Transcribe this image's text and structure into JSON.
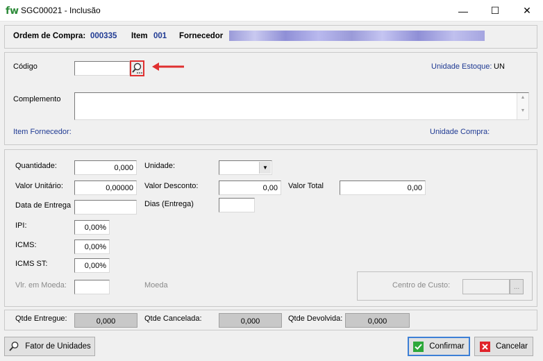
{
  "window": {
    "logo": "fw",
    "title": "SGC00021 - Inclusão",
    "minimize": "—",
    "maximize": "☐",
    "close": "✕"
  },
  "header": {
    "ordem_label": "Ordem de Compra:",
    "ordem_value": "000335",
    "item_label": "Item",
    "item_value": "001",
    "fornecedor_label": "Fornecedor"
  },
  "produto": {
    "codigo_label": "Código",
    "codigo_value": "",
    "unidade_estoque_label": "Unidade Estoque:",
    "unidade_estoque_value": "UN",
    "complemento_label": "Complemento",
    "complemento_value": "",
    "item_fornecedor_label": "Item Fornecedor:",
    "unidade_compra_label": "Unidade Compra:"
  },
  "valores": {
    "quantidade_label": "Quantidade:",
    "quantidade_value": "0,000",
    "unidade_label": "Unidade:",
    "unidade_value": "",
    "valor_unitario_label": "Valor Unitário:",
    "valor_unitario_value": "0,00000",
    "valor_desconto_label": "Valor Desconto:",
    "valor_desconto_value": "0,00",
    "valor_total_label": "Valor Total",
    "valor_total_value": "0,00",
    "data_entrega_label": "Data de Entrega",
    "data_entrega_value": "",
    "dias_entrega_label": "Dias (Entrega)",
    "dias_entrega_value": "",
    "ipi_label": "IPI:",
    "ipi_value": "0,00%",
    "icms_label": "ICMS:",
    "icms_value": "0,00%",
    "icms_st_label": "ICMS ST:",
    "icms_st_value": "0,00%",
    "vlr_moeda_label": "Vlr. em Moeda:",
    "vlr_moeda_value": "",
    "moeda_label": "Moeda",
    "centro_custo_label": "Centro de Custo:",
    "centro_custo_value": "",
    "centro_custo_btn": "..."
  },
  "totais": {
    "qtde_entregue_label": "Qtde Entregue:",
    "qtde_entregue_value": "0,000",
    "qtde_cancelada_label": "Qtde Cancelada:",
    "qtde_cancelada_value": "0,000",
    "qtde_devolvida_label": "Qtde Devolvida:",
    "qtde_devolvida_value": "0,000"
  },
  "buttons": {
    "fator": "Fator de Unidades",
    "confirmar": "Confirmar",
    "cancelar": "Cancelar"
  },
  "colors": {
    "label_blue": "#1f3a93",
    "annotation_red": "#e03030",
    "logo_green": "#2e8b3a"
  }
}
